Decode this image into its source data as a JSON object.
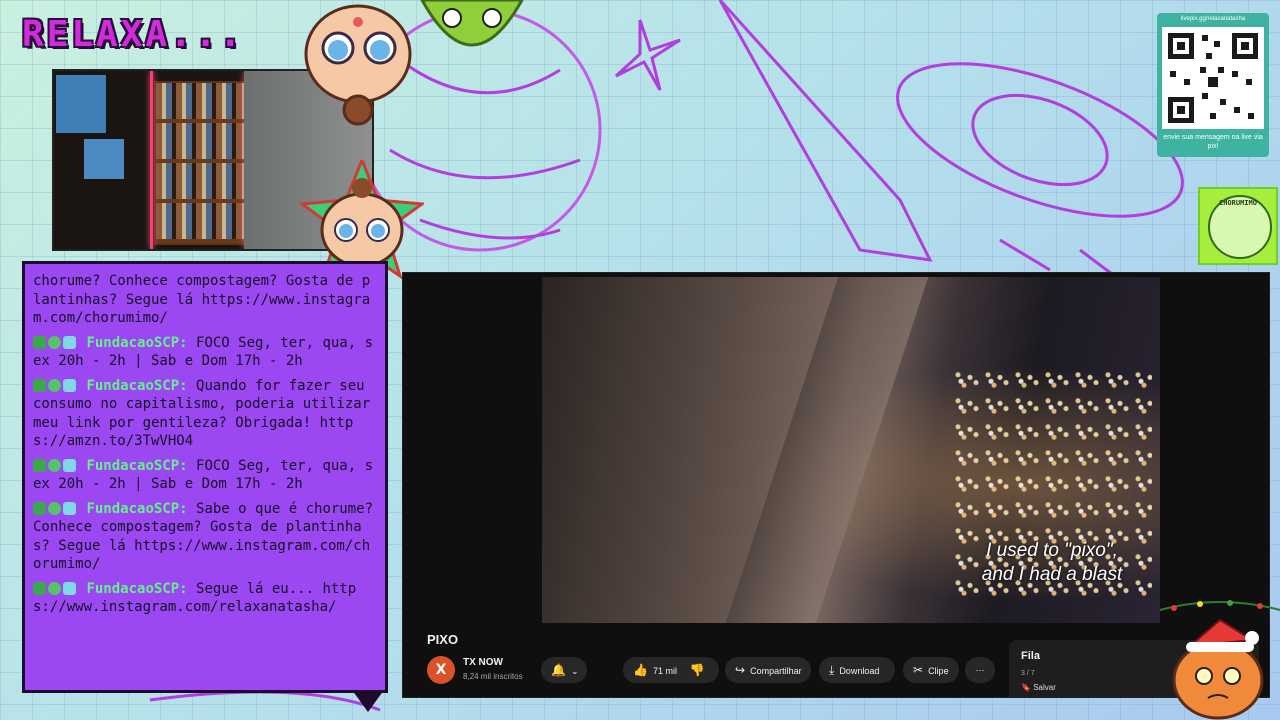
{
  "overlay": {
    "logo_text": "RELAXA..."
  },
  "chat": {
    "messages": [
      {
        "user": "",
        "text": "chorume? Conhece compostagem? Gosta de plantinhas? Segue lá https://www.instagram.com/chorumimo/"
      },
      {
        "user": "FundacaoSCP:",
        "text": " FOCO Seg, ter, qua, sex 20h - 2h | Sab e Dom 17h - 2h"
      },
      {
        "user": "FundacaoSCP:",
        "text": " Quando for fazer seu consumo no capitalismo, poderia utilizar meu link por gentileza? Obrigada! https://amzn.to/3TwVHO4"
      },
      {
        "user": "FundacaoSCP:",
        "text": " FOCO Seg, ter, qua, sex 20h - 2h | Sab e Dom 17h - 2h"
      },
      {
        "user": "FundacaoSCP:",
        "text": " Sabe o que é chorume? Conhece compostagem? Gosta de plantinhas? Segue lá https://www.instagram.com/chorumimo/"
      },
      {
        "user": "FundacaoSCP:",
        "text": " Segue lá eu... https://www.instagram.com/relaxanatasha/"
      }
    ],
    "badge_colors": [
      "#3aa84b",
      "#56c36b",
      "#7fd7e8"
    ]
  },
  "player": {
    "subtitle_line1": "I used to \"pixo\",",
    "subtitle_line2": "and I had a blast",
    "title": "PIXO",
    "channel_name": "TX NOW",
    "channel_subs": "8,24 mil inscritos",
    "channel_avatar_letter": "X",
    "bell_icon": "bell-icon",
    "like_count": "71 mil",
    "share_label": "Compartilhar",
    "download_label": "Download",
    "clip_label": "Clipe",
    "more_label": "···",
    "queue_title": "Fila",
    "queue_count": "3 / 7",
    "queue_save": "Salvar"
  },
  "qr": {
    "url": "livepix.gg/relaxanatasha",
    "message": "envie sua mensagem na live via pix!"
  },
  "sticker": {
    "label": "CHORUMIMO"
  },
  "colors": {
    "chat_bg": "#9b47f2",
    "username": "#67f08a",
    "logo": "#d22bdc",
    "qr_panel": "#3eb3a2",
    "sticker": "#a6ee3c"
  }
}
